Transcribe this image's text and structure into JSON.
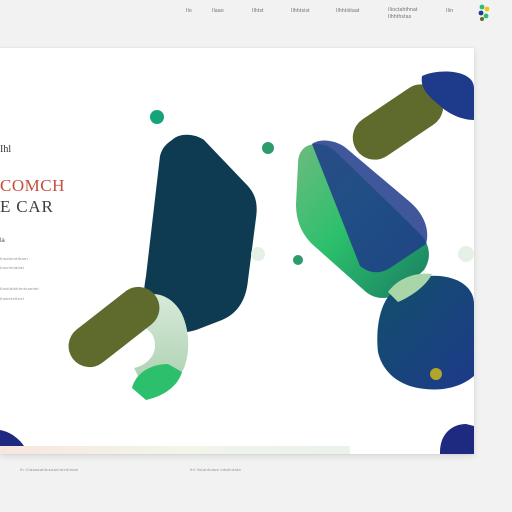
{
  "nav": {
    "items": [
      {
        "label": "Ilo"
      },
      {
        "label": "Ilaao"
      },
      {
        "label": "Ilhtst"
      },
      {
        "label": "Ilhhtsist"
      },
      {
        "label": "Ilhhtiiitaat"
      },
      {
        "label_line1": "Ilioctahthnat",
        "label_line2": "Ilhhthstas"
      },
      {
        "label": "Ilin"
      }
    ]
  },
  "hero": {
    "eyebrow": "Ihl",
    "title_line1": "COMCH",
    "title_line2": "E CAR",
    "subheading": "la"
  },
  "body_lines": [
    "Ihsdtsintthant",
    "Iosctmtatiat",
    "Ihsktdtkbhntcantmt",
    "Ihsketeltent"
  ],
  "footer": {
    "left": "Ih Ctaasaahtnsaacheedimae",
    "right": "Ihi Ilstantcasa mtatintata"
  },
  "colors": {
    "card": "#ffffff",
    "background": "#f1f2f1",
    "navy": "#0f3b52",
    "blue": "#1e3a8a",
    "green": "#2cc06c",
    "olive": "#5f6b2c",
    "accent_red": "#c64c3b"
  }
}
